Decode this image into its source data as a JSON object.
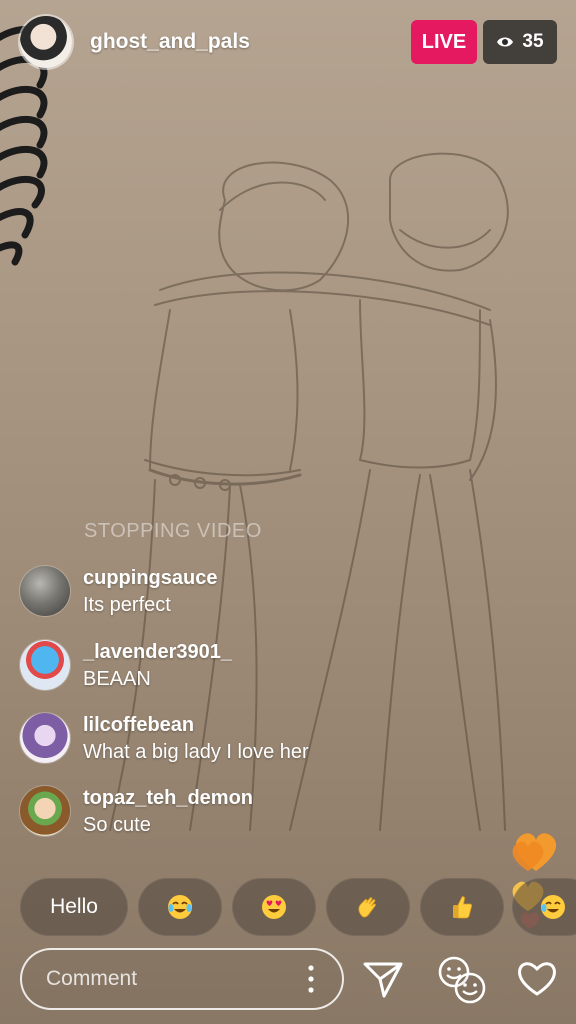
{
  "header": {
    "host_name": "ghost_and_pals",
    "live_label": "LIVE",
    "viewer_count": "35",
    "viewer_icon": "eye-icon"
  },
  "overlay": {
    "status_text": "STOPPING VIDEO"
  },
  "comments": [
    {
      "user": "cuppingsauce",
      "message": "Its perfect"
    },
    {
      "user": "_lavender3901_",
      "message": "BEAAN"
    },
    {
      "user": "lilcoffebean",
      "message": "What a big lady I love her"
    },
    {
      "user": "topaz_teh_demon",
      "message": "So cute"
    }
  ],
  "quick_replies": {
    "hello_label": "Hello",
    "emojis": [
      "tears-of-joy-emoji",
      "heart-eyes-emoji",
      "waving-hand-emoji",
      "thumbs-up-emoji",
      "tears-of-joy-emoji"
    ]
  },
  "composer": {
    "placeholder": "Comment",
    "more_icon": "more-vertical-icon",
    "send_icon": "send-icon",
    "effects_icon": "faces-icon",
    "like_icon": "heart-icon"
  },
  "colors": {
    "live": "#e5195f",
    "viewer_bg": "#2a2a2a",
    "heart_orange": "#f29a2e",
    "heart_yellow": "#f6c24a"
  }
}
